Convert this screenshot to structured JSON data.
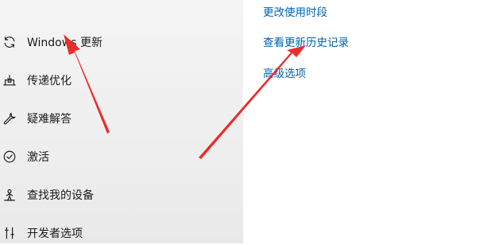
{
  "sidebar": {
    "items": [
      {
        "label": "Windows 更新",
        "icon": "sync-icon"
      },
      {
        "label": "传递优化",
        "icon": "delivery-optimization-icon"
      },
      {
        "label": "疑难解答",
        "icon": "wrench-icon"
      },
      {
        "label": "激活",
        "icon": "check-circle-icon"
      },
      {
        "label": "查找我的设备",
        "icon": "person-location-icon"
      },
      {
        "label": "开发者选项",
        "icon": "developer-tools-icon"
      }
    ]
  },
  "content": {
    "links": [
      {
        "label": "更改使用时段"
      },
      {
        "label": "查看更新历史记录"
      },
      {
        "label": "高级选项"
      }
    ]
  },
  "colors": {
    "link": "#0063b1",
    "arrow": "#ee2a2a",
    "sidebar_bg": "#f0f0f0",
    "content_bg": "#ffffff"
  }
}
